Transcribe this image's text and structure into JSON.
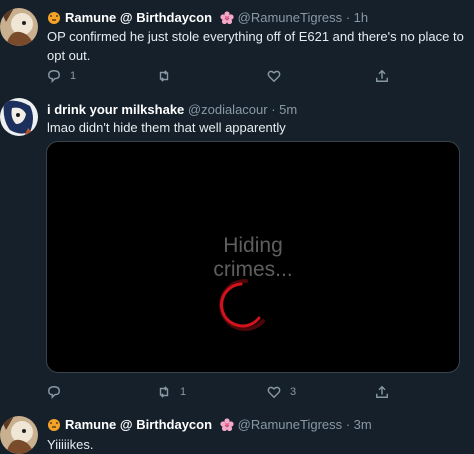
{
  "tweets": [
    {
      "display_name": "Ramune @ Birthdaycon",
      "handle": "@RamuneTigress · 1h",
      "text": "OP confirmed he just stole everything off of E621 and there's no place to opt out.",
      "reply_count": "1",
      "retweet_count": "",
      "like_count": ""
    },
    {
      "display_name": "i drink your milkshake",
      "handle": "@zodialacour · 5m",
      "text": "lmao didn't hide them that well apparently",
      "media_caption_line1": "Hiding",
      "media_caption_line2": "crimes...",
      "reply_count": "",
      "retweet_count": "1",
      "like_count": "3"
    },
    {
      "display_name": "Ramune @ Birthdaycon",
      "handle": "@RamuneTigress · 3m",
      "text": "Yiiiiikes."
    }
  ],
  "icons": [
    "tiger-emoji-icon",
    "cherry-blossom-icon",
    "reply-icon",
    "retweet-icon",
    "like-icon",
    "share-icon",
    "loading-spinner-icon"
  ],
  "colors": {
    "background": "#15202b",
    "secondary_text": "#8899a6",
    "spinner": "#c0121a"
  }
}
